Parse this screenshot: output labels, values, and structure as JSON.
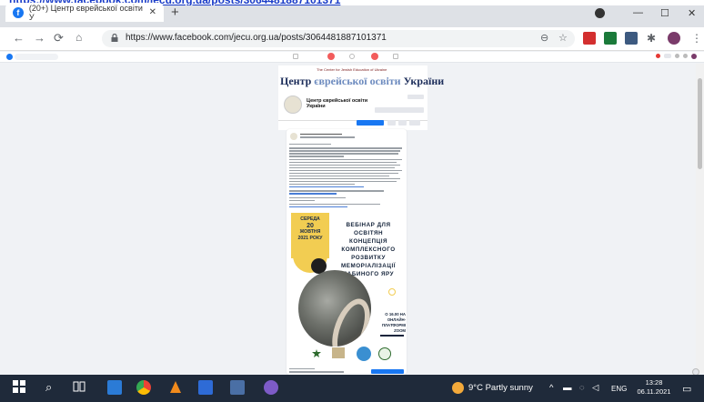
{
  "browser": {
    "tab_title": "(20+) Центр єврейської освіти У",
    "tab_close": "✕",
    "new_tab": "+",
    "url": "https://www.facebook.com/jecu.org.ua/posts/3064481887101371"
  },
  "page": {
    "cover_title_part1": "Центр ",
    "cover_title_part2": "єврейської освіти ",
    "cover_title_part3": "України",
    "cover_subtitle": "The Center for Jewish Education of Ukraine",
    "page_name": "Центр єврейської освіти України"
  },
  "post": {
    "banner_date": [
      "СЕРЕДА",
      "20",
      "ЖОВТНЯ",
      "2021 РОКУ"
    ],
    "banner_title": [
      "ВЕБІНАР ДЛЯ",
      "ОСВІТЯН",
      "КОНЦЕПЦІЯ",
      "КОМПЛЕКСНОГО",
      "РОЗВИТКУ",
      "МЕМОРІАЛІЗАЦІЇ",
      "БАБИНОГО ЯРУ"
    ],
    "banner_time": [
      "О 16.00 НА",
      "ОНЛАЙН-",
      "ПЛАТФОРМІ",
      "ZOOM"
    ]
  },
  "taskbar": {
    "weather": "9°C  Partly sunny",
    "lang": "ENG",
    "time": "13:28",
    "date": "06.11.2021"
  },
  "colors": {
    "accent": "#1877f2",
    "banner_yellow": "#f2cd52",
    "taskbar": "#1f2a3a"
  }
}
